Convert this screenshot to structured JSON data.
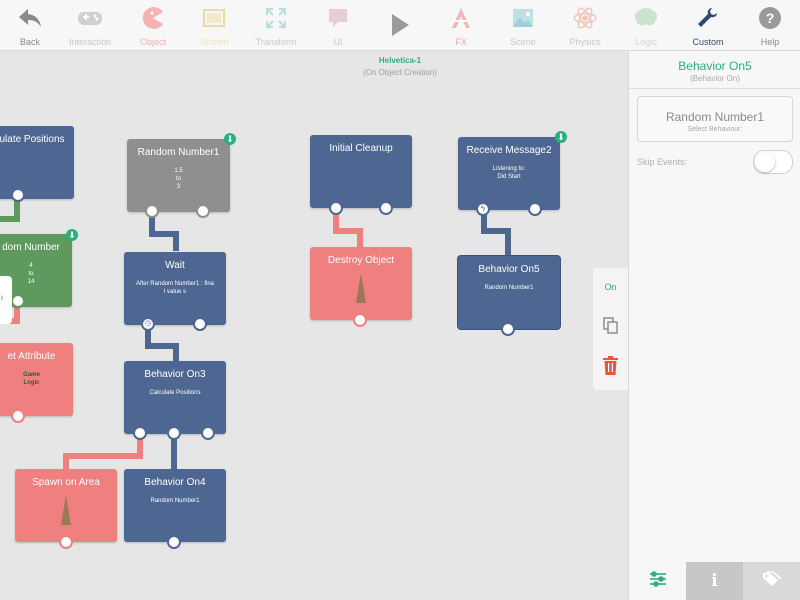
{
  "toolbar": {
    "items": [
      {
        "label": "Back",
        "icon": "back-arrow-icon"
      },
      {
        "label": "Interaction",
        "icon": "gamepad-icon"
      },
      {
        "label": "Object",
        "icon": "pacman-icon"
      },
      {
        "label": "Screen",
        "icon": "screen-icon"
      },
      {
        "label": "Transform",
        "icon": "transform-icon"
      },
      {
        "label": "UI",
        "icon": "speech-bubble-icon"
      },
      {
        "label": "",
        "icon": "play-icon"
      },
      {
        "label": "FX",
        "icon": "fx-icon"
      },
      {
        "label": "Scene",
        "icon": "landscape-icon"
      },
      {
        "label": "Physics",
        "icon": "atom-icon"
      },
      {
        "label": "Logic",
        "icon": "brain-icon"
      },
      {
        "label": "Custom",
        "icon": "wrench-icon"
      },
      {
        "label": "Help",
        "icon": "help-icon"
      }
    ],
    "active": "Custom"
  },
  "canvas": {
    "title": "Helvetica-1",
    "subtitle": "(On Object Creation)"
  },
  "nodes": {
    "calculate_positions": {
      "title": "ulate Positions"
    },
    "random_number_green": {
      "title": "dom Number",
      "detail": "4\nto\n14"
    },
    "set_attribute": {
      "title": "et Attribute",
      "detail": "Game\nLogic"
    },
    "random_number1": {
      "title": "Random Number1",
      "detail": "1.5\nto\n3"
    },
    "wait": {
      "title": "Wait",
      "detail": "After Random Number1 : fina\nl value s"
    },
    "behavior_on3": {
      "title": "Behavior On3",
      "detail": "Calculate Positions"
    },
    "spawn_on_area": {
      "title": "Spawn on Area"
    },
    "behavior_on4": {
      "title": "Behavior On4",
      "detail": "Random Number1"
    },
    "initial_cleanup": {
      "title": "Initial Cleanup"
    },
    "destroy_object": {
      "title": "Destroy Object"
    },
    "receive_message2": {
      "title": "Receive Message2",
      "detail": "Listening to:\nDid Start"
    },
    "behavior_on5": {
      "title": "Behavior On5",
      "detail": "Random Number1"
    }
  },
  "mini_toolbar": {
    "on_label": "On",
    "copy_icon": "copy-icon",
    "delete_icon": "trash-icon"
  },
  "panel": {
    "title": "Behavior On5",
    "subtitle": "(Behavior On)",
    "select_value": "Random Number1",
    "select_placeholder": "Select Behaviour:",
    "skip_events_label": "Skip Events:",
    "skip_events_on": false,
    "tabs": [
      "sliders-icon",
      "info-icon",
      "tags-icon"
    ]
  },
  "colors": {
    "accent": "#27b27a",
    "node_blue": "#4d6792",
    "node_red": "#f07f80",
    "node_green": "#5e9a5e",
    "node_gray": "#8f8f8f",
    "delete_red": "#e8553f"
  }
}
